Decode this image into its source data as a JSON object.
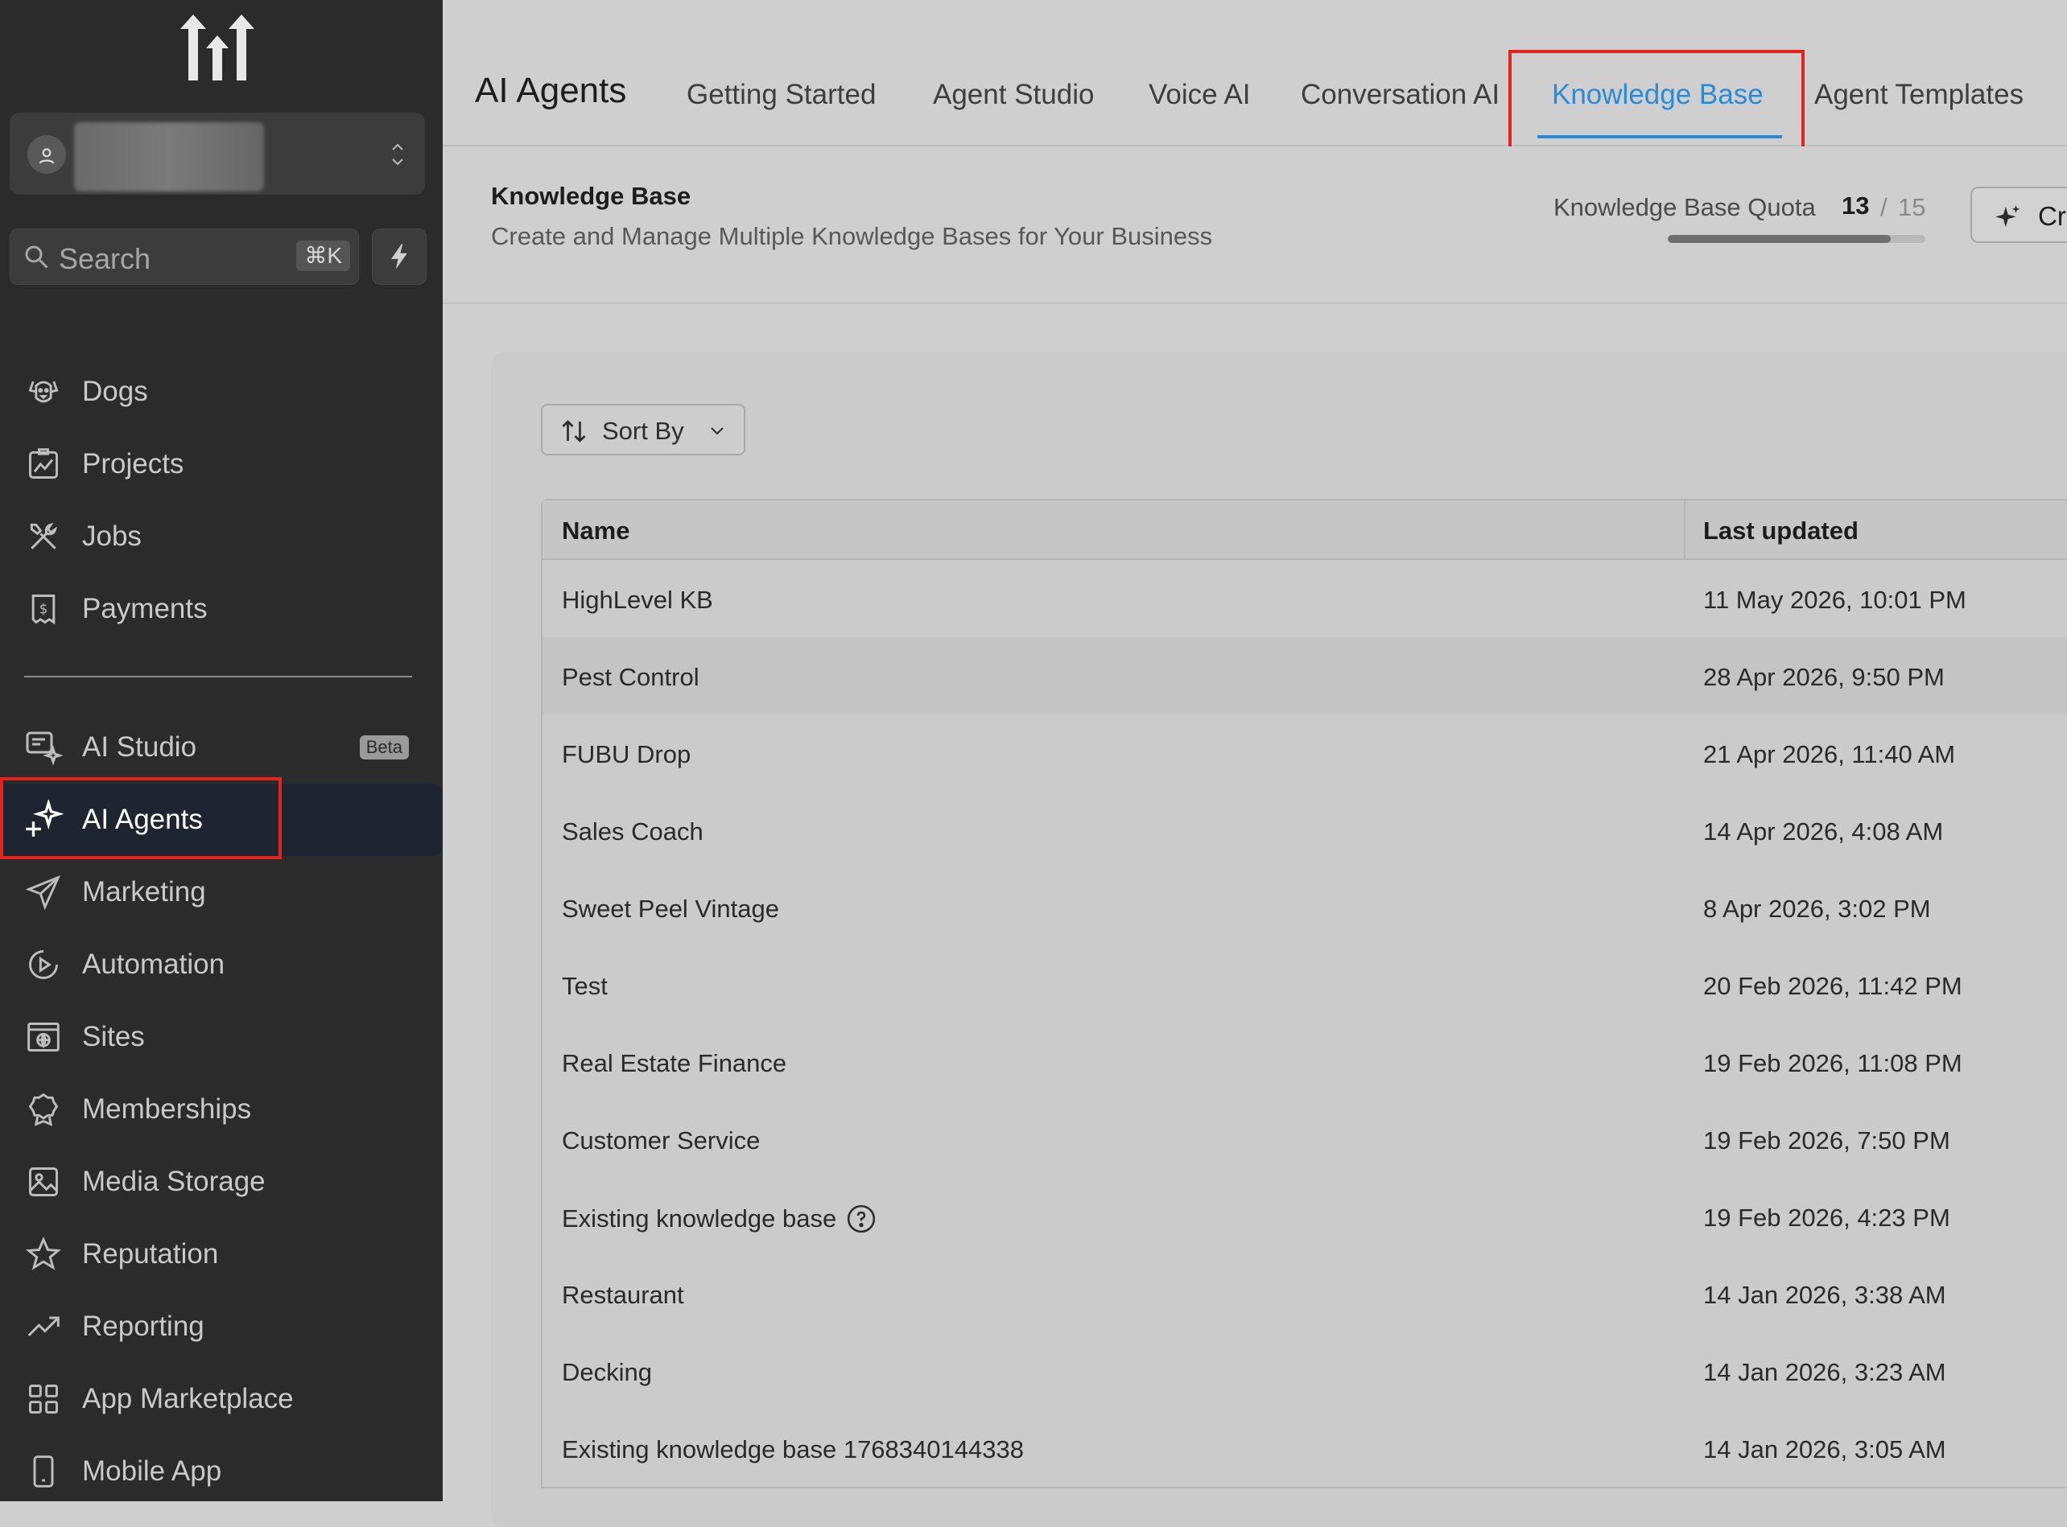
{
  "sidebar": {
    "search": {
      "label": "Search",
      "shortcut": "⌘K"
    },
    "nav": [
      {
        "label": "Dogs",
        "icon": "dog-icon"
      },
      {
        "label": "Projects",
        "icon": "projects-icon"
      },
      {
        "label": "Jobs",
        "icon": "tools-icon"
      },
      {
        "label": "Payments",
        "icon": "receipt-icon"
      },
      {
        "label": "AI Studio",
        "icon": "ai-studio-icon",
        "badge": "Beta"
      },
      {
        "label": "AI Agents",
        "icon": "sparkle-icon",
        "active": true
      },
      {
        "label": "Marketing",
        "icon": "send-icon"
      },
      {
        "label": "Automation",
        "icon": "play-circle-icon"
      },
      {
        "label": "Sites",
        "icon": "globe-icon"
      },
      {
        "label": "Memberships",
        "icon": "award-icon"
      },
      {
        "label": "Media Storage",
        "icon": "image-icon"
      },
      {
        "label": "Reputation",
        "icon": "star-icon"
      },
      {
        "label": "Reporting",
        "icon": "trend-icon"
      },
      {
        "label": "App Marketplace",
        "icon": "grid-icon"
      },
      {
        "label": "Mobile App",
        "icon": "phone-icon"
      }
    ]
  },
  "header": {
    "title": "AI Agents",
    "tabs": [
      {
        "label": "Getting Started"
      },
      {
        "label": "Agent Studio"
      },
      {
        "label": "Voice AI"
      },
      {
        "label": "Conversation AI"
      },
      {
        "label": "Knowledge Base",
        "active": true
      },
      {
        "label": "Agent Templates"
      }
    ]
  },
  "page": {
    "title": "Knowledge Base",
    "subtitle": "Create and Manage Multiple Knowledge Bases for Your Business",
    "quota": {
      "label": "Knowledge Base Quota",
      "used": "13",
      "separator": "/",
      "total": "15",
      "fraction": 0.8667
    },
    "create_label": "Cr"
  },
  "toolbar": {
    "sort_label": "Sort By"
  },
  "table": {
    "columns": [
      "Name",
      "Last updated"
    ],
    "rows": [
      {
        "name": "HighLevel KB",
        "updated": "11 May 2026, 10:01 PM"
      },
      {
        "name": "Pest Control",
        "updated": "28 Apr 2026, 9:50 PM"
      },
      {
        "name": "FUBU Drop",
        "updated": "21 Apr 2026, 11:40 AM"
      },
      {
        "name": "Sales Coach",
        "updated": "14 Apr 2026, 4:08 AM"
      },
      {
        "name": "Sweet Peel Vintage",
        "updated": "8 Apr 2026, 3:02 PM"
      },
      {
        "name": "Test",
        "updated": "20 Feb 2026, 11:42 PM"
      },
      {
        "name": "Real Estate Finance",
        "updated": "19 Feb 2026, 11:08 PM"
      },
      {
        "name": "Customer Service",
        "updated": "19 Feb 2026, 7:50 PM"
      },
      {
        "name": "Existing knowledge base",
        "updated": "19 Feb 2026, 4:23 PM",
        "help": true
      },
      {
        "name": "Restaurant",
        "updated": "14 Jan 2026, 3:38 AM"
      },
      {
        "name": "Decking",
        "updated": "14 Jan 2026, 3:23 AM"
      },
      {
        "name": "Existing knowledge base 1768340144338",
        "updated": "14 Jan 2026, 3:05 AM"
      }
    ]
  },
  "colors": {
    "accent": "#2a8ad6",
    "highlight_box": "#e5221c",
    "sidebar_bg": "#2b2b2b"
  }
}
